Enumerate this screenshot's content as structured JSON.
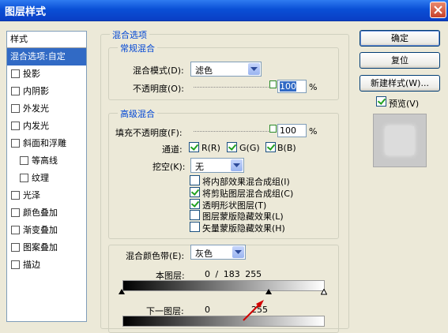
{
  "window": {
    "title": "图层样式"
  },
  "sidebar": {
    "header": "样式",
    "items": [
      {
        "label": "混合选项:自定",
        "selected": true
      },
      {
        "label": "投影"
      },
      {
        "label": "内阴影"
      },
      {
        "label": "外发光"
      },
      {
        "label": "内发光"
      },
      {
        "label": "斜面和浮雕"
      },
      {
        "label": "等高线"
      },
      {
        "label": "纹理"
      },
      {
        "label": "光泽"
      },
      {
        "label": "颜色叠加"
      },
      {
        "label": "渐变叠加"
      },
      {
        "label": "图案叠加"
      },
      {
        "label": "描边"
      }
    ]
  },
  "blend_options": {
    "group_title": "混合选项",
    "general": {
      "title": "常规混合",
      "mode_label": "混合模式(D):",
      "mode_value": "滤色",
      "opacity_label": "不透明度(O):",
      "opacity_value": "100",
      "opacity_unit": "%",
      "opacity_level": 1.0
    },
    "advanced": {
      "title": "高级混合",
      "fill_label": "填充不透明度(F):",
      "fill_value": "100",
      "fill_unit": "%",
      "fill_level": 1.0,
      "channels_label": "通道:",
      "channel_r": "R(R)",
      "channel_g": "G(G)",
      "channel_b": "B(B)",
      "knockout_label": "挖空(K):",
      "knockout_value": "无",
      "options": [
        {
          "label": "将内部效果混合成组(I)",
          "checked": false
        },
        {
          "label": "将剪贴图层混合成组(C)",
          "checked": true
        },
        {
          "label": "透明形状图层(T)",
          "checked": true
        },
        {
          "label": "图层蒙版隐藏效果(L)",
          "checked": false
        },
        {
          "label": "矢量蒙版隐藏效果(H)",
          "checked": false
        }
      ]
    },
    "blend_if": {
      "label": "混合颜色带(E):",
      "value": "灰色",
      "this_layer_label": "本图层:",
      "this_layer_values": "0 / 183  255",
      "under_layer_label": "下一图层:",
      "under_low": "0",
      "under_high": "255"
    }
  },
  "buttons": {
    "ok": "确定",
    "reset": "复位",
    "new_style": "新建样式(W)...",
    "preview": "预览(V)"
  }
}
